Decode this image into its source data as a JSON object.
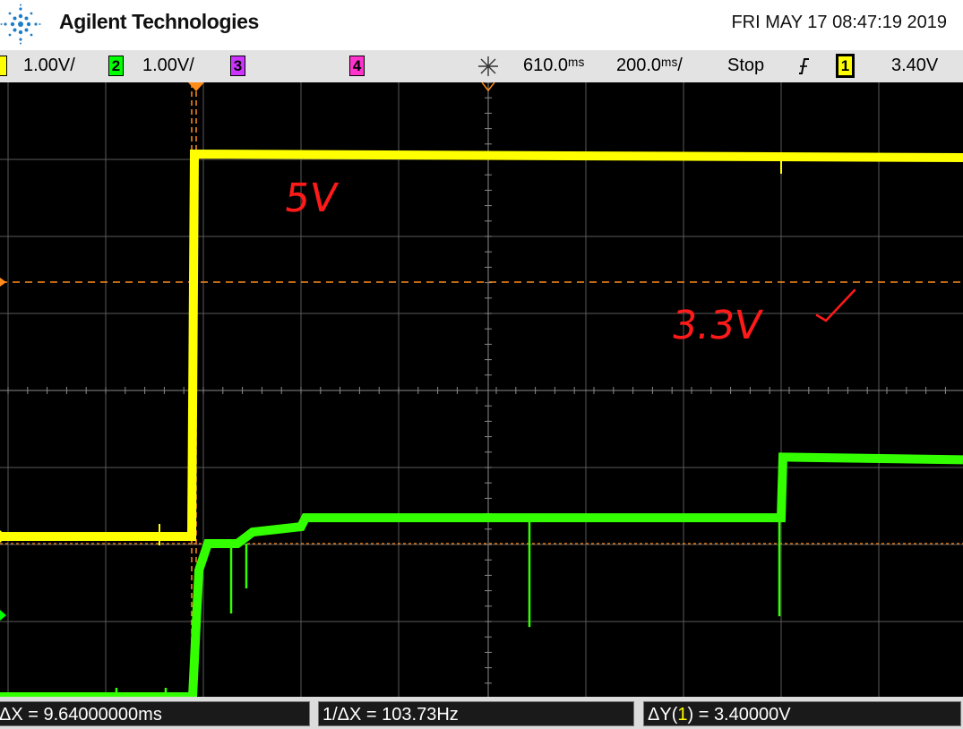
{
  "header": {
    "brand": "Agilent Technologies",
    "datetime": "FRI MAY 17 08:47:19 2019",
    "logo_icon": "agilent-spark-logo-icon"
  },
  "status_bar": {
    "ch1": {
      "scale": "1.00V/",
      "color": "#ffff00"
    },
    "ch2": {
      "number": "2",
      "scale": "1.00V/",
      "color": "#00ff00"
    },
    "ch3": {
      "number": "3",
      "color": "#cc33ff"
    },
    "ch4": {
      "number": "4",
      "color": "#ff33cc"
    },
    "time_offset": "610.0ᵐˢ",
    "time_scale": "200.0ᵐˢ/",
    "run_state": "Stop",
    "trigger_source": "1",
    "trigger_level": "3.40V"
  },
  "annotations": {
    "label_5v": "5V",
    "label_3v3": "3.3V",
    "check_mark": "checkmark-icon"
  },
  "traces": {
    "ch1": {
      "color": "#ffff00",
      "low_level_v": 0.0,
      "high_level_v": 5.0
    },
    "ch2": {
      "color": "#33ff00",
      "levels_v": [
        -1.0,
        0.7,
        1.0,
        1.15,
        2.1
      ]
    }
  },
  "measurements": {
    "delta_x": "ΔX = 9.64000000ms",
    "inverse_delta_x": "1/ΔX = 103.73Hz",
    "delta_y_prefix": "ΔY(",
    "delta_y_channel": "1",
    "delta_y_suffix": ") = 3.40000V"
  },
  "colors": {
    "screen_bg": "#000000",
    "cursor_color": "#ff8c1a",
    "grid_color": "#5a5a5a"
  }
}
